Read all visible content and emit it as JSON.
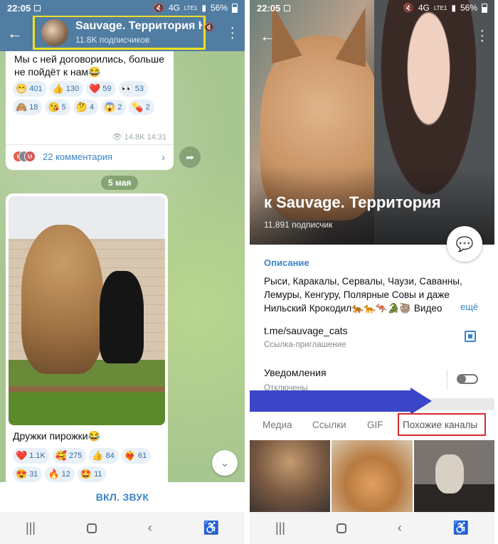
{
  "status": {
    "time": "22:05",
    "network": "4G",
    "lte": "LTE1",
    "battery": "56%"
  },
  "left": {
    "channel_name": "Sauvage. Территория К",
    "subscribers": "11.8K подписчиков",
    "msg1": {
      "text": "Мы с ней договорились, больше не пойдёт к нам😂",
      "reactions": [
        {
          "emoji": "😁",
          "count": "401"
        },
        {
          "emoji": "👍",
          "count": "130"
        },
        {
          "emoji": "❤️",
          "count": "59"
        },
        {
          "emoji": "👀",
          "count": "53"
        },
        {
          "emoji": "🙈",
          "count": "18"
        },
        {
          "emoji": "😘",
          "count": "5"
        },
        {
          "emoji": "🤔",
          "count": "4"
        },
        {
          "emoji": "😱",
          "count": "2"
        },
        {
          "emoji": "💊",
          "count": "2"
        }
      ],
      "views": "14.8K",
      "time": "14:31",
      "comments": "22 комментария",
      "avatar_letters": [
        "К",
        "М"
      ]
    },
    "date_pill": "5 мая",
    "msg2": {
      "text": "Дружки пирожки😂",
      "reactions": [
        {
          "emoji": "❤️",
          "count": "1.1K"
        },
        {
          "emoji": "🥰",
          "count": "275"
        },
        {
          "emoji": "👍",
          "count": "84"
        },
        {
          "emoji": "❤️‍🔥",
          "count": "61"
        },
        {
          "emoji": "😍",
          "count": "31"
        },
        {
          "emoji": "🔥",
          "count": "12"
        },
        {
          "emoji": "🤩",
          "count": "11"
        }
      ]
    },
    "sound_button": "ВКЛ. ЗВУК"
  },
  "right": {
    "title": "к   Sauvage. Территория",
    "subscribers": "11,891 подписчик",
    "desc_label": "Описание",
    "description": "Рыси, Каракалы, Сервалы, Чаузи, Саванны, Лемуры, Кенгуру, Полярные Совы и даже Нильский Крокодил🐅🐆🦘🐊🦥 Видео",
    "more": "ещё",
    "link": "t.me/sauvage_cats",
    "link_sub": "Ссылка-приглашение",
    "notif_label": "Уведомления",
    "notif_sub": "Отключены",
    "tabs": [
      "Медиа",
      "Ссылки",
      "GIF",
      "Похожие каналы"
    ]
  }
}
